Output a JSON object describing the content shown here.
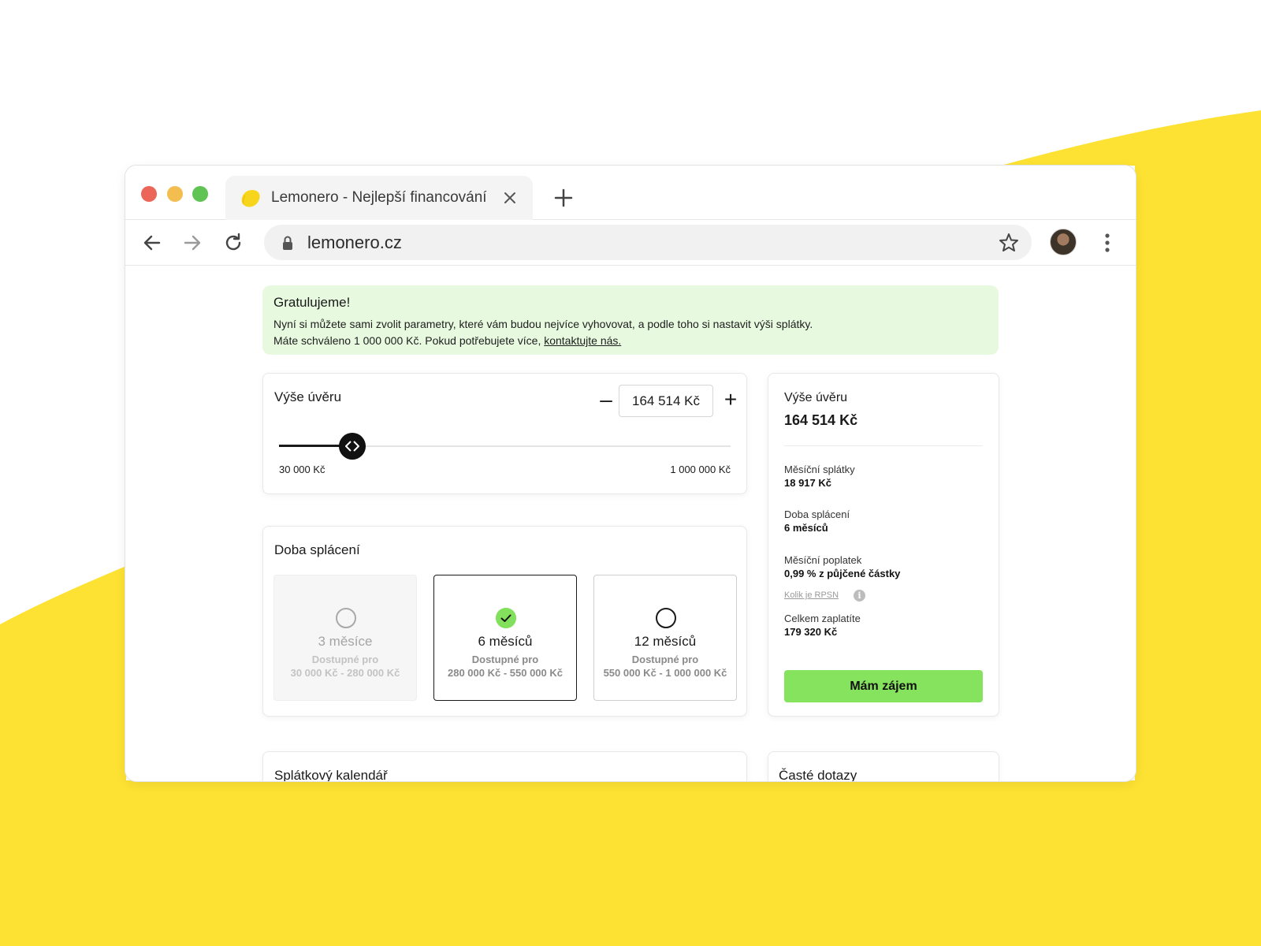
{
  "colors": {
    "brand_yellow": "#fde233",
    "banner_green": "#e7f9df",
    "accent_green": "#86e35e",
    "dark": "#111111"
  },
  "browser": {
    "tab_title": "Lemonero - Nejlepší financování",
    "favicon": "lemon-icon",
    "url": "lemonero.cz",
    "icons": [
      "back-arrow-icon",
      "forward-arrow-icon",
      "reload-icon",
      "lock-icon",
      "star-icon",
      "avatar",
      "more-vert-icon",
      "close-icon",
      "plus-icon"
    ]
  },
  "banner": {
    "title": "Gratulujeme!",
    "line1": "Nyní si můžete sami zvolit parametry, které vám budou nejvíce vyhovovat, a podle toho si nastavit výši splátky.",
    "line2": "Máte schváleno 1 000 000 Kč. Pokud potřebujete více, ",
    "link": "kontaktujte nás."
  },
  "loan": {
    "title": "Výše úvěru",
    "minus": "–",
    "plus": "+",
    "amount": "164 514 Kč",
    "min_label": "30 000 Kč",
    "max_label": "1 000 000 Kč",
    "slider_position": 0.163
  },
  "term": {
    "title": "Doba splácení",
    "options": [
      {
        "label": "3 měsíce",
        "sub": "Dostupné pro",
        "range": "30 000 Kč - 280 000 Kč",
        "state": "disabled"
      },
      {
        "label": "6 měsíců",
        "sub": "Dostupné pro",
        "range": "280 000 Kč - 550 000 Kč",
        "state": "selected"
      },
      {
        "label": "12 měsíců",
        "sub": "Dostupné pro",
        "range": "550 000 Kč - 1 000 000 Kč",
        "state": "available"
      }
    ]
  },
  "summary": {
    "title": "Výše úvěru",
    "amount": "164 514 Kč",
    "monthly_label": "Měsíční splátky",
    "monthly_value": "18 917 Kč",
    "term_label": "Doba splácení",
    "term_value": "6 měsíců",
    "fee_label": "Měsíční poplatek",
    "fee_value": "0,99 % z půjčené částky",
    "rpsn_link": "Kolik je RPSN",
    "total_label": "Celkem zaplatíte",
    "total_value": "179 320 Kč",
    "cta": "Mám zájem"
  },
  "calendar": {
    "title": "Splátkový kalendář"
  },
  "faq": {
    "title": "Časté dotazy"
  }
}
